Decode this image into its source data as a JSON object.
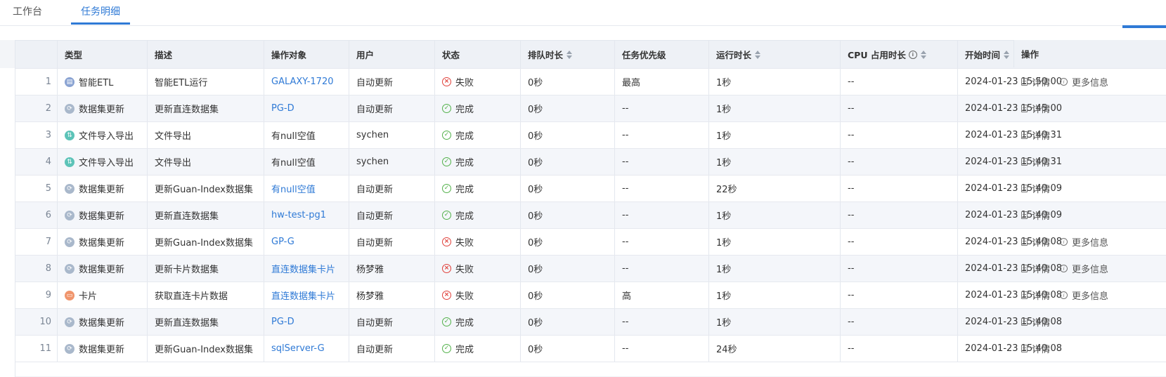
{
  "tabs": [
    {
      "label": "工作台"
    },
    {
      "label": "任务明细"
    }
  ],
  "columns": {
    "type": "类型",
    "desc": "描述",
    "target": "操作对象",
    "user": "用户",
    "status": "状态",
    "queue": "排队时长",
    "priority": "任务优先级",
    "run": "运行时长",
    "cpu": "CPU 占用时长",
    "start": "开始时间",
    "action": "操作"
  },
  "actions": {
    "detail": "详情",
    "more": "更多信息"
  },
  "rows": [
    {
      "no": "1",
      "type": "智能ETL",
      "desc": "智能ETL运行",
      "target": "GALAXY-1720",
      "user": "自动更新",
      "status": "失败",
      "queue": "0秒",
      "priority": "最高",
      "run": "1秒",
      "cpu": "--",
      "start": "2024-01-23 15:50:00"
    },
    {
      "no": "2",
      "type": "数据集更新",
      "desc": "更新直连数据集",
      "target": "PG-D",
      "user": "自动更新",
      "status": "完成",
      "queue": "0秒",
      "priority": "--",
      "run": "1秒",
      "cpu": "--",
      "start": "2024-01-23 15:45:00"
    },
    {
      "no": "3",
      "type": "文件导入导出",
      "desc": "文件导出",
      "target": "有null空值",
      "user": "sychen",
      "status": "完成",
      "queue": "0秒",
      "priority": "--",
      "run": "1秒",
      "cpu": "--",
      "start": "2024-01-23 15:40:31"
    },
    {
      "no": "4",
      "type": "文件导入导出",
      "desc": "文件导出",
      "target": "有null空值",
      "user": "sychen",
      "status": "完成",
      "queue": "0秒",
      "priority": "--",
      "run": "1秒",
      "cpu": "--",
      "start": "2024-01-23 15:40:31"
    },
    {
      "no": "5",
      "type": "数据集更新",
      "desc": "更新Guan-Index数据集",
      "target": "有null空值",
      "user": "自动更新",
      "status": "完成",
      "queue": "0秒",
      "priority": "--",
      "run": "22秒",
      "cpu": "--",
      "start": "2024-01-23 15:40:09"
    },
    {
      "no": "6",
      "type": "数据集更新",
      "desc": "更新直连数据集",
      "target": "hw-test-pg1",
      "user": "自动更新",
      "status": "完成",
      "queue": "0秒",
      "priority": "--",
      "run": "1秒",
      "cpu": "--",
      "start": "2024-01-23 15:40:09"
    },
    {
      "no": "7",
      "type": "数据集更新",
      "desc": "更新Guan-Index数据集",
      "target": "GP-G",
      "user": "自动更新",
      "status": "失败",
      "queue": "0秒",
      "priority": "--",
      "run": "1秒",
      "cpu": "--",
      "start": "2024-01-23 15:40:08"
    },
    {
      "no": "8",
      "type": "数据集更新",
      "desc": "更新卡片数据集",
      "target": "直连数据集卡片",
      "user": "杨梦雅",
      "status": "失败",
      "queue": "0秒",
      "priority": "--",
      "run": "1秒",
      "cpu": "--",
      "start": "2024-01-23 15:40:08"
    },
    {
      "no": "9",
      "type": "卡片",
      "desc": "获取直连卡片数据",
      "target": "直连数据集卡片",
      "user": "杨梦雅",
      "status": "失败",
      "queue": "0秒",
      "priority": "高",
      "run": "1秒",
      "cpu": "--",
      "start": "2024-01-23 15:40:08"
    },
    {
      "no": "10",
      "type": "数据集更新",
      "desc": "更新直连数据集",
      "target": "PG-D",
      "user": "自动更新",
      "status": "完成",
      "queue": "0秒",
      "priority": "--",
      "run": "1秒",
      "cpu": "--",
      "start": "2024-01-23 15:40:08"
    },
    {
      "no": "11",
      "type": "数据集更新",
      "desc": "更新Guan-Index数据集",
      "target": "sqlServer-G",
      "user": "自动更新",
      "status": "完成",
      "queue": "0秒",
      "priority": "--",
      "run": "24秒",
      "cpu": "--",
      "start": "2024-01-23 15:40:08"
    }
  ]
}
